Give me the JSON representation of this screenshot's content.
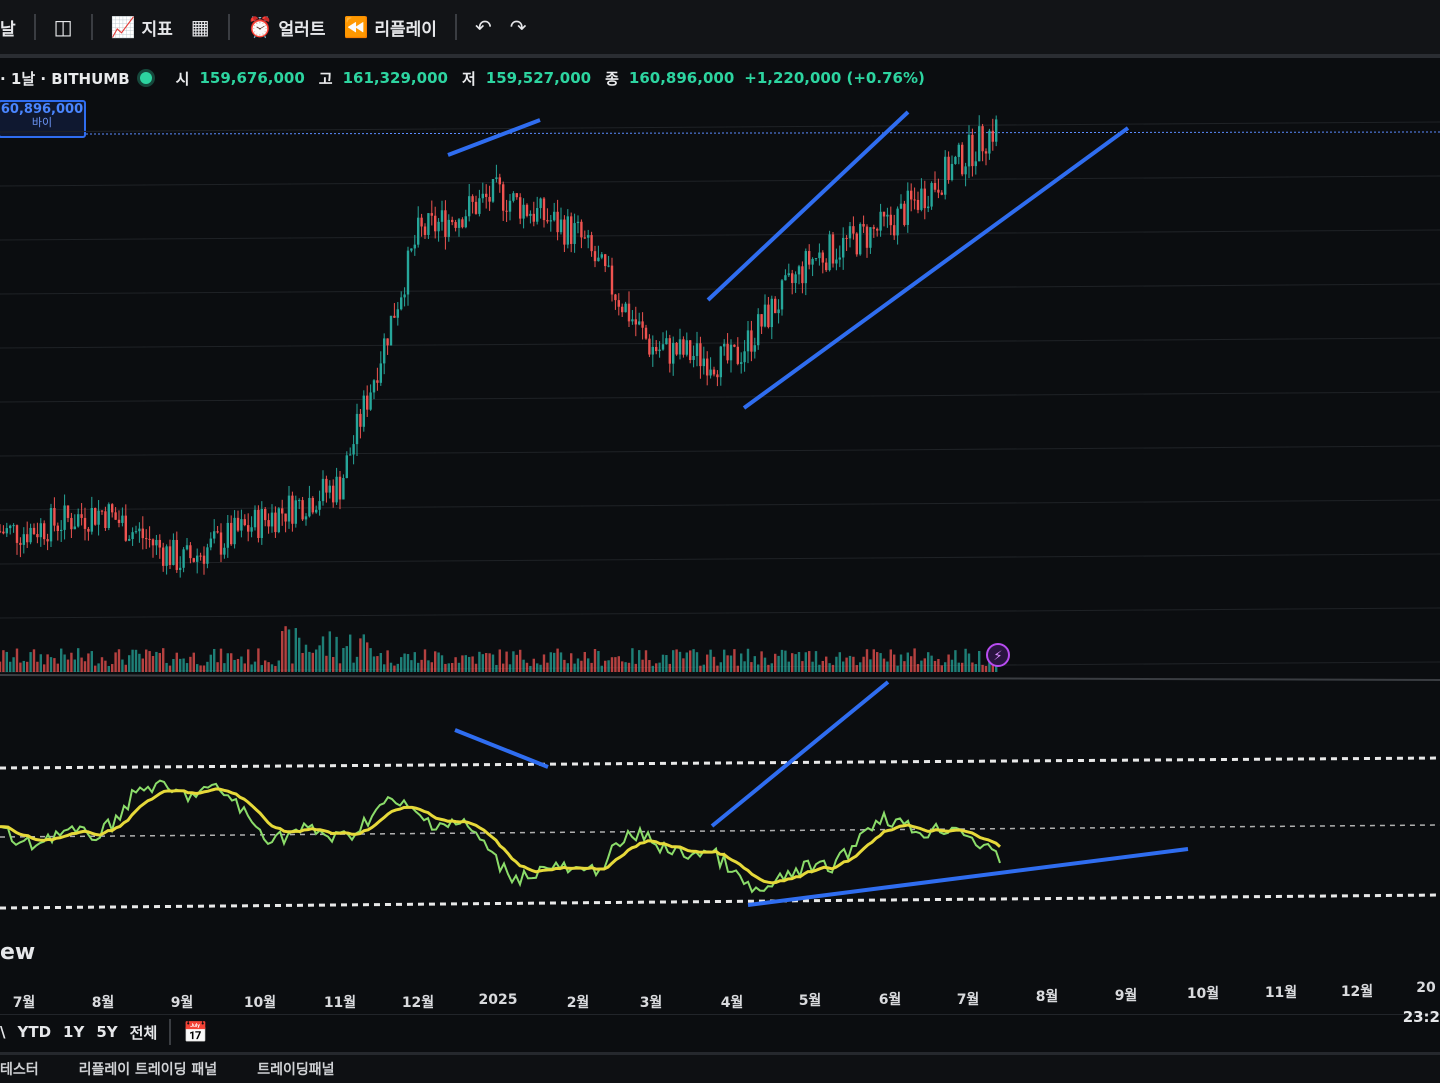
{
  "toolbar": {
    "partial_left": "날",
    "indicators_label": "지표",
    "alert_label": "얼러트",
    "replay_label": "리플레이"
  },
  "symbol": {
    "title": "· 1날 · BITHUMB",
    "open_key": "시",
    "open": "159,676,000",
    "high_key": "고",
    "high": "161,329,000",
    "low_key": "저",
    "low": "159,527,000",
    "close_key": "종",
    "close": "160,896,000",
    "change": "+1,220,000 (+0.76%)"
  },
  "price_tag": {
    "value": "60,896,000",
    "label": "바이"
  },
  "watermark": "ew",
  "colors": {
    "up": "#26a69a",
    "down": "#ef5350",
    "trendline": "#2f6df0",
    "indicator_fast": "#8bdc6a",
    "indicator_slow": "#e6d93a",
    "accent_dot": "#2dd4a0"
  },
  "x_axis": [
    "7월",
    "8월",
    "9월",
    "10월",
    "11월",
    "12월",
    "2025",
    "2월",
    "3월",
    "4월",
    "5월",
    "6월",
    "7월",
    "8월",
    "9월",
    "10월",
    "11월",
    "12월",
    "20"
  ],
  "time_ranges": [
    "YTD",
    "1Y",
    "5Y",
    "전체"
  ],
  "time_partial_left": "\\",
  "clock": "23:2",
  "panels": [
    "테스터",
    "리플레이 트레이딩 패널",
    "트레이딩패널"
  ],
  "chart_data": {
    "type": "line",
    "interval": "1D",
    "exchange": "BITHUMB",
    "x": [
      "7월",
      "8월",
      "9월",
      "10월",
      "11월",
      "12월",
      "2025",
      "2월",
      "3월",
      "4월",
      "5월",
      "6월",
      "7월"
    ],
    "series": [
      {
        "values": [
          82,
          86,
          76,
          84,
          91,
          140,
          148,
          140,
          118,
          115,
          135,
          142,
          160.9
        ]
      }
    ],
    "ylabel": "",
    "last_price": 160896000,
    "volume_panel": true,
    "oscillator_panel": true,
    "grid": true
  }
}
